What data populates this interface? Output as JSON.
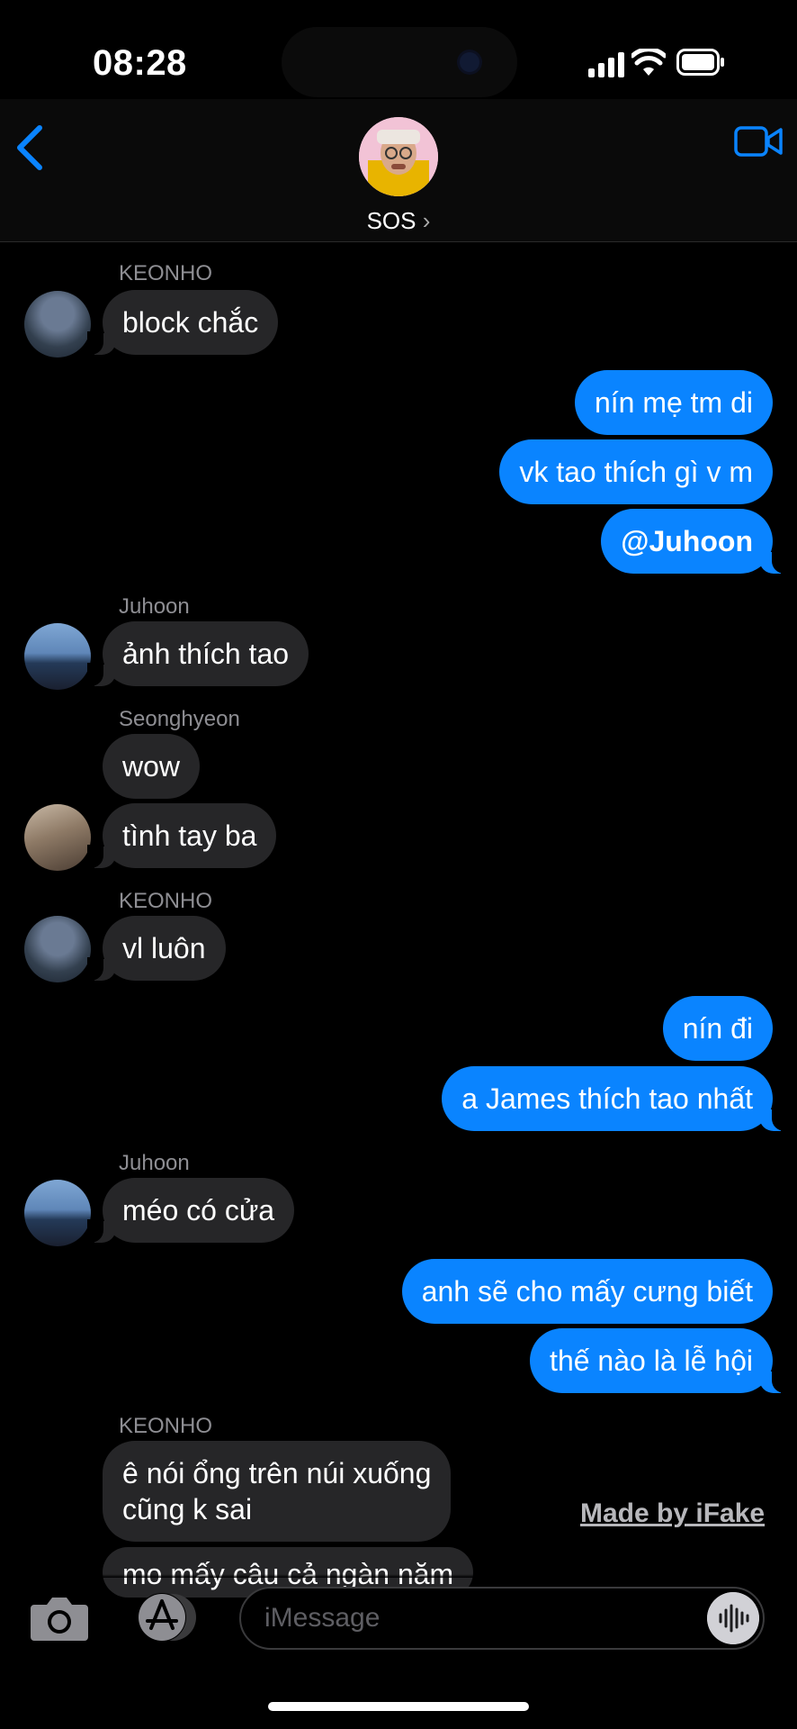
{
  "status": {
    "time": "08:28"
  },
  "header": {
    "title": "SOS",
    "chevron": "›"
  },
  "messages": {
    "m1_sender": "KEONHO",
    "m1_text": "block chắc",
    "m2_text": "nín mẹ tm di",
    "m3_text": "vk tao thích gì v m",
    "m4_text": "@Juhoon",
    "m5_sender": "Juhoon",
    "m5_text": "ảnh thích tao",
    "m6_sender": "Seonghyeon",
    "m6_text": "wow",
    "m7_text": "tình tay ba",
    "m8_sender": "KEONHO",
    "m8_text": "vl luôn",
    "m9_text": "nín đi",
    "m10_text": "a James thích tao nhất",
    "m11_sender": "Juhoon",
    "m11_text": "méo có cửa",
    "m12_text": "anh sẽ cho mấy cưng biết",
    "m13_text": "thế nào là lễ hội",
    "m14_sender": "KEONHO",
    "m14_line1": "ê nói ổng trên núi xuống",
    "m14_line2": "cũng k sai",
    "m15_text": "mo mấy câu cả ngàn năm"
  },
  "watermark": "Made by iFake",
  "composer": {
    "placeholder": "iMessage"
  },
  "colors": {
    "outgoing": "#0a84ff",
    "incoming": "#262628",
    "accent": "#0a84ff"
  }
}
